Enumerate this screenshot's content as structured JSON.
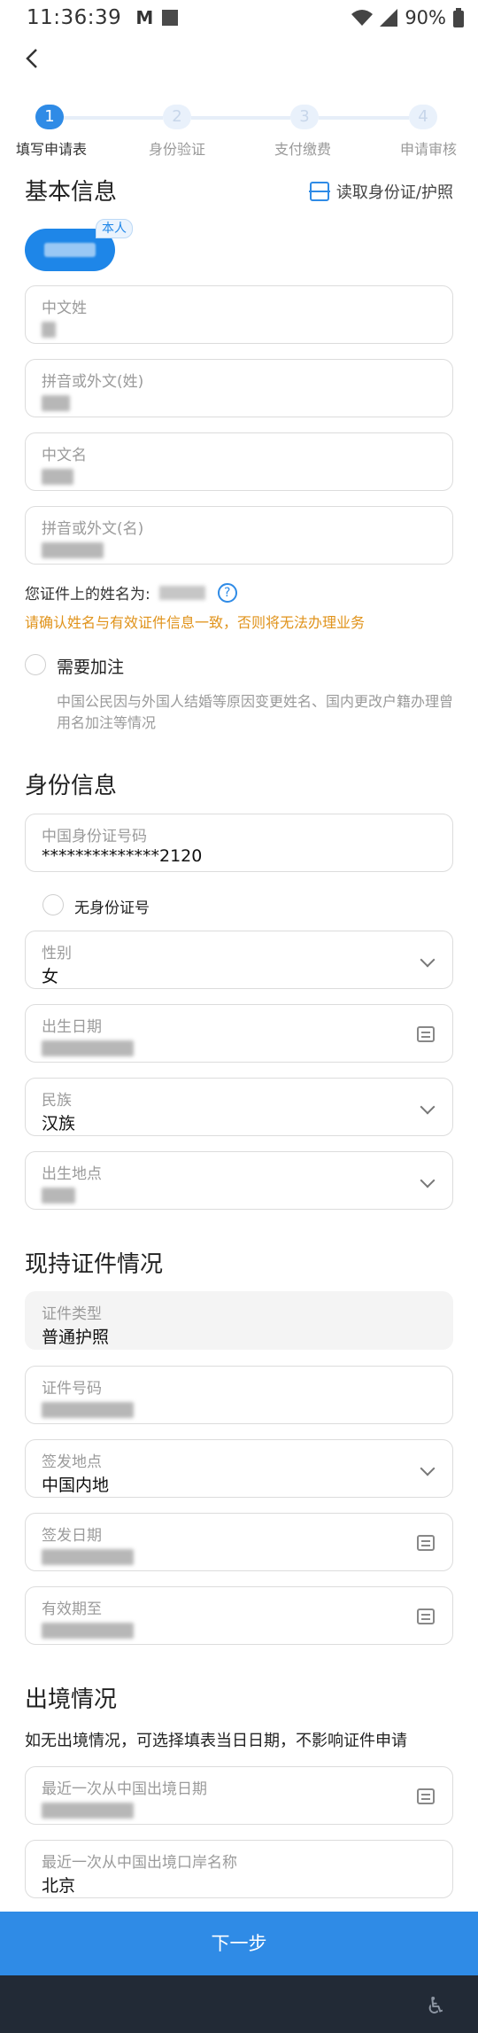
{
  "status_bar": {
    "time": "11:36:39",
    "carrier_glyph": "M",
    "battery": "90%"
  },
  "stepper": {
    "steps": [
      {
        "num": "1",
        "label": "填写申请表"
      },
      {
        "num": "2",
        "label": "身份验证"
      },
      {
        "num": "3",
        "label": "支付缴费"
      },
      {
        "num": "4",
        "label": "申请审核"
      }
    ]
  },
  "basic_info": {
    "title": "基本信息",
    "read_id_label": "读取身份证/护照",
    "chip_tag": "本人",
    "fields": {
      "chinese_surname": {
        "label": "中文姓"
      },
      "pinyin_surname": {
        "label": "拼音或外文(姓)"
      },
      "chinese_given": {
        "label": "中文名"
      },
      "pinyin_given": {
        "label": "拼音或外文(名)"
      }
    },
    "name_on_card_label": "您证件上的姓名为:",
    "help_glyph": "?",
    "warning": "请确认姓名与有效证件信息一致，否则将无法办理业务",
    "need_add_label": "需要加注",
    "need_add_note": "中国公民因与外国人结婚等原因变更姓名、国内更改户籍办理曾用名加注等情况"
  },
  "identity_info": {
    "title": "身份信息",
    "id_number": {
      "label": "中国身份证号码",
      "value": "**************2120"
    },
    "no_id_label": "无身份证号",
    "gender": {
      "label": "性别",
      "value": "女"
    },
    "birth_date": {
      "label": "出生日期"
    },
    "ethnicity": {
      "label": "民族",
      "value": "汉族"
    },
    "birthplace": {
      "label": "出生地点"
    }
  },
  "current_cert": {
    "title": "现持证件情况",
    "cert_type": {
      "label": "证件类型",
      "value": "普通护照"
    },
    "cert_number": {
      "label": "证件号码"
    },
    "issue_place": {
      "label": "签发地点",
      "value": "中国内地"
    },
    "issue_date": {
      "label": "签发日期"
    },
    "valid_until": {
      "label": "有效期至"
    }
  },
  "exit_info": {
    "title": "出境情况",
    "hint": "如无出境情况，可选择填表当日日期，不影响证件申请",
    "last_exit_date": {
      "label": "最近一次从中国出境日期"
    },
    "last_exit_port": {
      "label": "最近一次从中国出境口岸名称",
      "value": "北京"
    }
  },
  "footer": {
    "next_label": "下一步",
    "accessibility_glyph": "♿"
  },
  "colors": {
    "accent": "#2f8be6",
    "warning": "#e0931b",
    "navbar": "#222a36"
  }
}
